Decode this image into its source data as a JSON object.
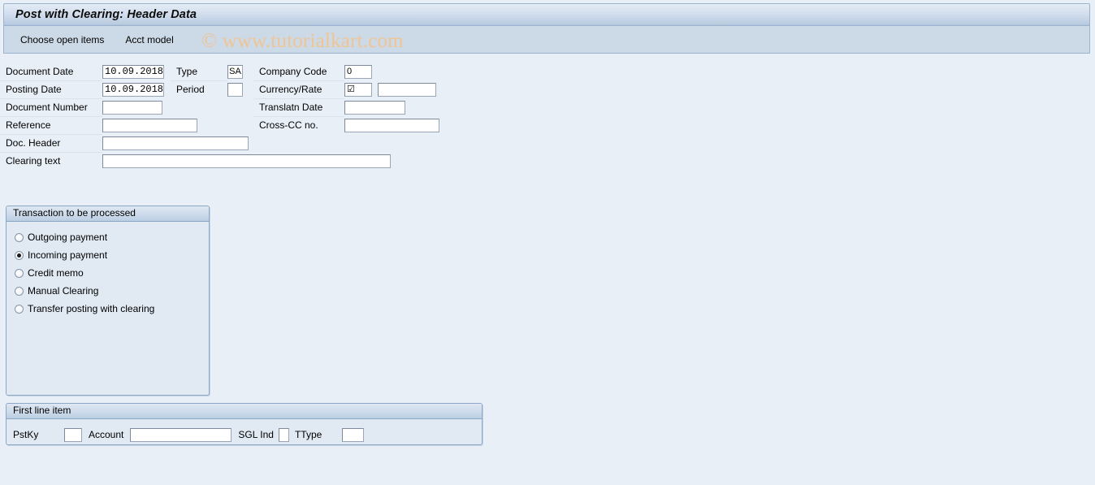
{
  "window": {
    "title": "Post with Clearing: Header Data"
  },
  "toolbar": {
    "buttons": [
      {
        "label": "Choose open items",
        "name": "choose-open-items-button"
      },
      {
        "label": "Acct model",
        "name": "acct-model-button"
      }
    ]
  },
  "watermark": {
    "text": "© www.tutorialkart.com",
    "color": "#f0c493"
  },
  "header_form": {
    "rows": [
      {
        "col1": {
          "label": "Document Date",
          "value": "10.09.2018",
          "placeholder": ""
        },
        "col2": {
          "label": "Type",
          "value": "SA",
          "placeholder": ""
        },
        "col3": {
          "label": "Company Code",
          "value": "0",
          "placeholder": ""
        }
      },
      {
        "col1": {
          "label": "Posting Date",
          "value": "10.09.2018",
          "placeholder": ""
        },
        "col2": {
          "label": "Period",
          "value": "",
          "placeholder": ""
        },
        "col3": {
          "label": "Currency/Rate",
          "value": "☑",
          "placeholder": ""
        }
      },
      {
        "col1": {
          "label": "Document Number",
          "value": "",
          "placeholder": ""
        },
        "col3": {
          "label": "Translatn Date",
          "value": "",
          "placeholder": ""
        }
      },
      {
        "col1": {
          "label": "Reference",
          "value": "",
          "placeholder": ""
        },
        "col3": {
          "label": "Cross-CC no.",
          "value": "",
          "placeholder": ""
        }
      },
      {
        "col1": {
          "label": "Doc. Header",
          "value": "",
          "placeholder": ""
        }
      },
      {
        "col1": {
          "label": "Clearing text",
          "value": "",
          "placeholder": ""
        }
      }
    ],
    "rate_value": ""
  },
  "transaction_group": {
    "title": "Transaction to be processed",
    "options": [
      {
        "label": "Outgoing payment",
        "selected": false
      },
      {
        "label": "Incoming payment",
        "selected": true
      },
      {
        "label": "Credit memo",
        "selected": false
      },
      {
        "label": "Manual Clearing",
        "selected": false
      },
      {
        "label": "Transfer posting with clearing",
        "selected": false
      }
    ]
  },
  "first_line_item": {
    "title": "First line item",
    "pstky_label": "PstKy",
    "pstky_value": "",
    "account_label": "Account",
    "account_value": "",
    "sgl_ind_label": "SGL Ind",
    "sgl_ind_value": "",
    "ttype_label": "TType",
    "ttype_value": ""
  },
  "colors": {
    "page_background": "#e9eff7",
    "titlebar_border": "#9bb3cf",
    "toolbar_background": "#ccd9e6",
    "group_border": "#8ca8c6",
    "group_background": "#e1e9f3"
  }
}
